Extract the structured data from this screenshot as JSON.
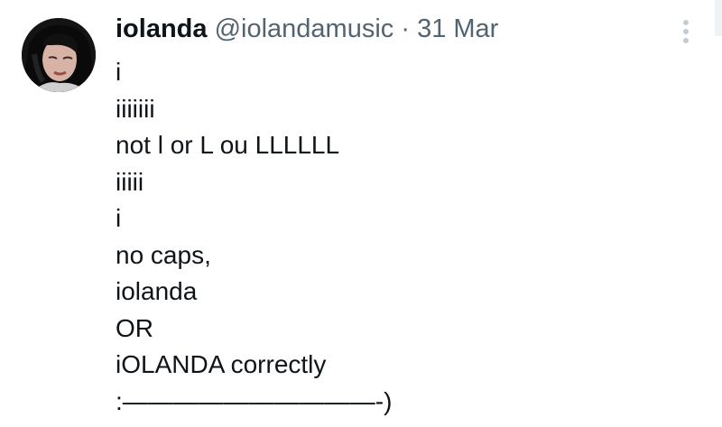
{
  "tweet": {
    "author_name": "iolanda",
    "handle": "@iolandamusic",
    "separator": "·",
    "date": "31 Mar",
    "avatar_icon": "profile-photo",
    "more_icon": "more-vertical-icon",
    "lines": [
      "i",
      "iiiiiii",
      "not l or L ou LLLLLL",
      "iiiii",
      "i",
      "no caps,",
      "iolanda",
      "OR",
      "iOLANDA correctly",
      ":——————————-)"
    ]
  }
}
